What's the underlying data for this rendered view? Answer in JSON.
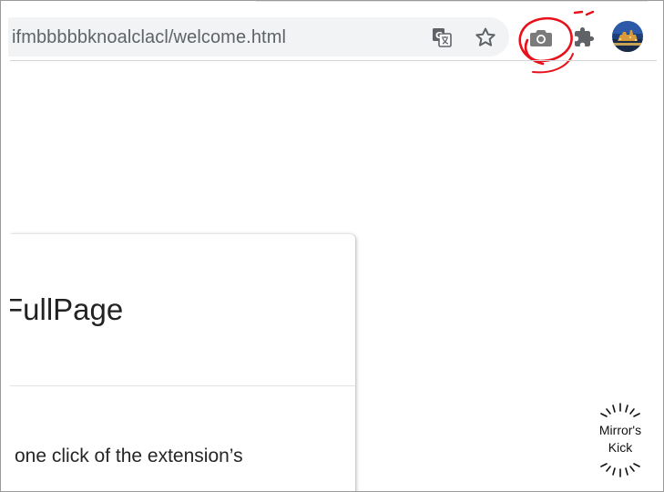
{
  "browser": {
    "address_bar": {
      "url_text": "ifmbbbbbknoalclacl/welcome.html"
    },
    "toolbar_icons": [
      "translate-icon",
      "star-icon",
      "camera-icon",
      "puzzle-icon",
      "avatar"
    ],
    "annotation_color": "#e8101a"
  },
  "card": {
    "title": "FullPage",
    "body_text": "one click of the extension’s"
  },
  "watermark": {
    "line1": "Mirror's",
    "line2": "Kick"
  }
}
